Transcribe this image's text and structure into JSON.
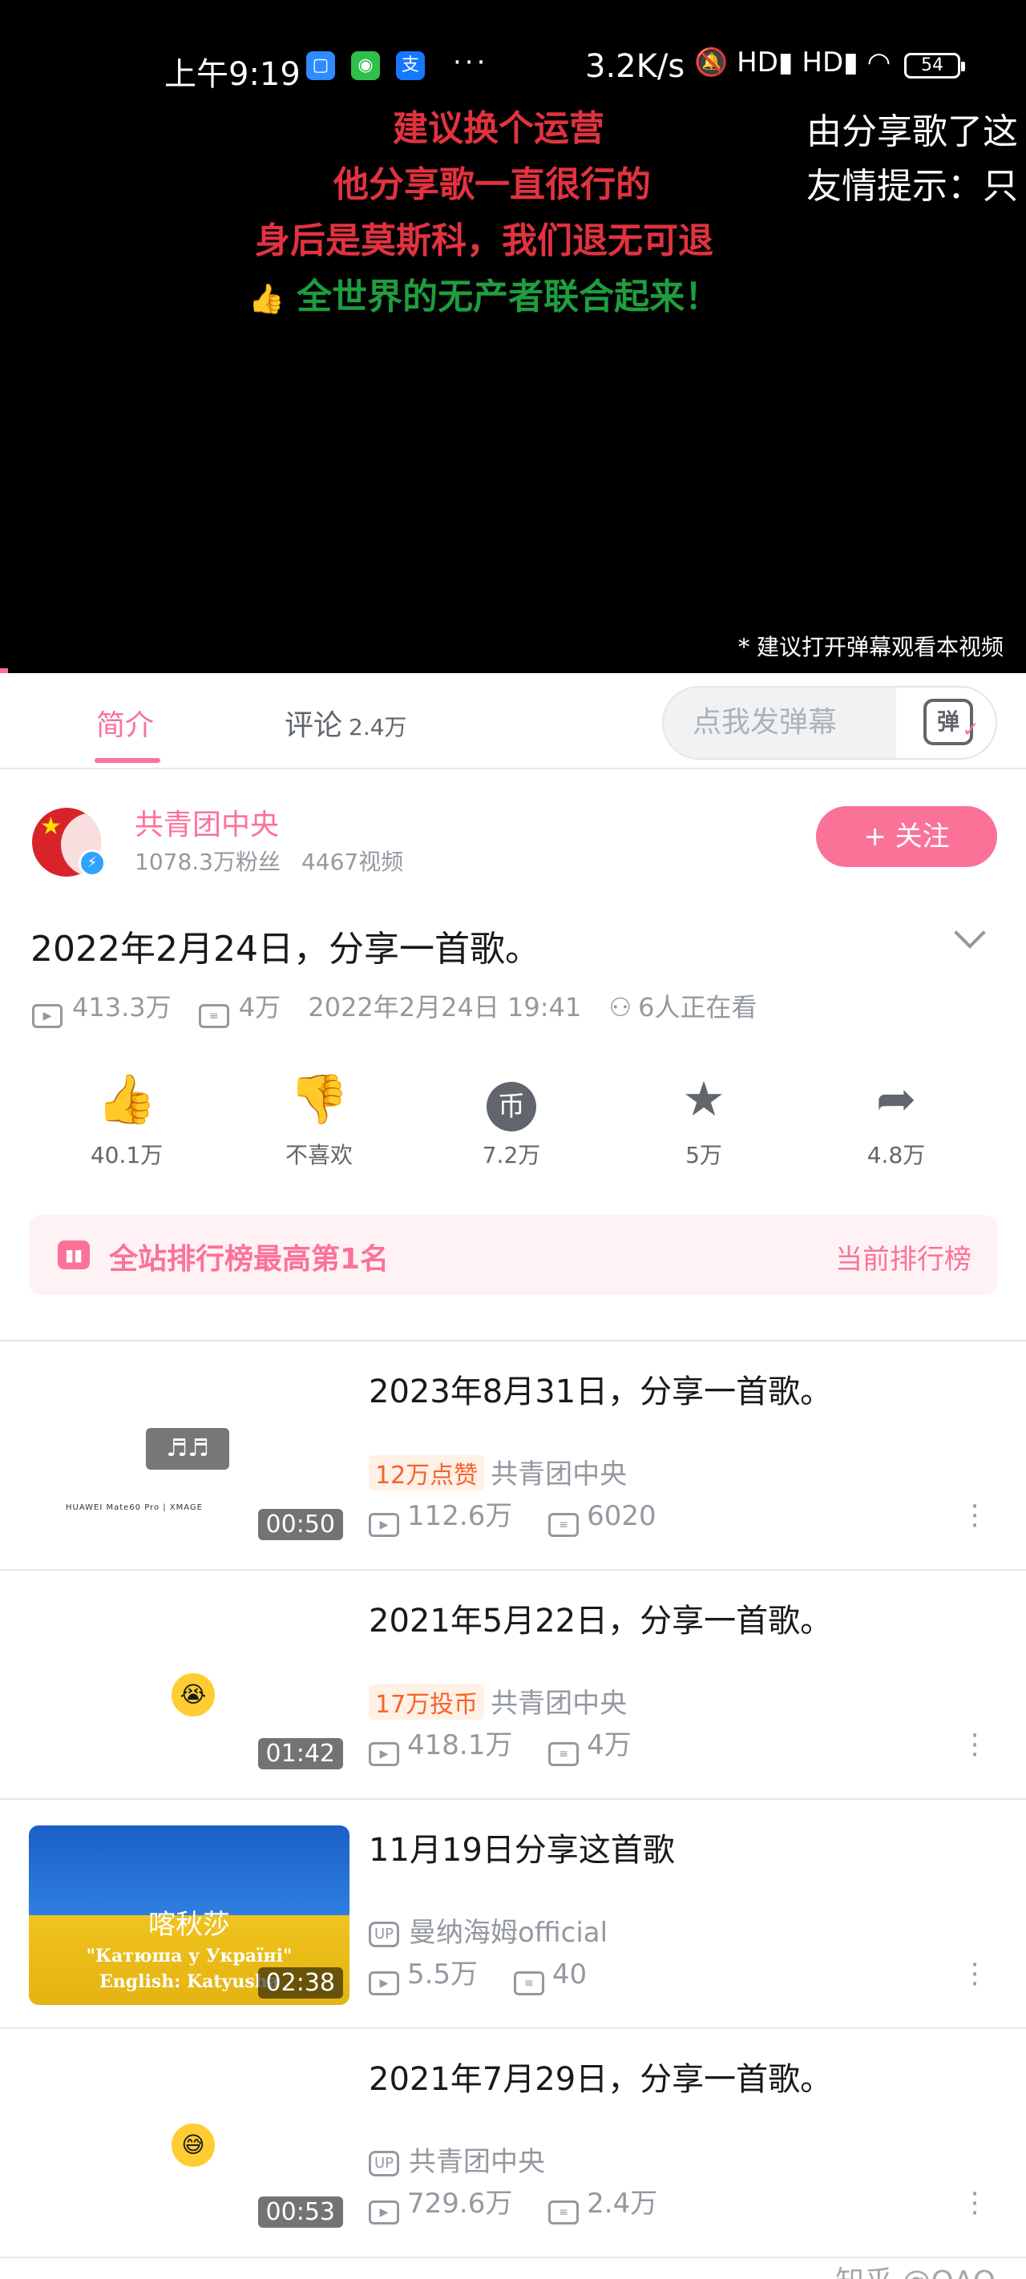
{
  "status_bar": {
    "time": "上午9:19",
    "app_icons": [
      "message-icon",
      "wechat-icon",
      "alipay-icon"
    ],
    "dots": "···",
    "network_speed": "3.2K/s",
    "indicators": "🔕 HD▮ HD▮ ◠",
    "battery": "54"
  },
  "video": {
    "danmaku": [
      {
        "text": "建议换个运营",
        "color": "#e2323f"
      },
      {
        "text": "他分享歌一直很行的",
        "color": "#e2323f"
      },
      {
        "text": "身后是莫斯科，我们退无可退",
        "color": "#e2323f"
      },
      {
        "text": "全世界的无产者联合起来！",
        "color": "#1f9d3f"
      },
      {
        "text": "由分享歌了这",
        "color": "#ffffff"
      },
      {
        "text": "友情提示：只",
        "color": "#ffffff"
      }
    ],
    "like_emoji": "👍",
    "hint": "* 建议打开弹幕观看本视频"
  },
  "tabs": {
    "intro": "简介",
    "comments": "评论",
    "comments_count": "2.4万",
    "danmaku_placeholder": "点我发弹幕",
    "danmaku_icon_text": "弹"
  },
  "uploader": {
    "name": "共青团中央",
    "followers": "1078.3万粉丝",
    "videos": "4467视频",
    "follow_label": "+ 关注"
  },
  "video_info": {
    "title": "2022年2月24日，分享一首歌。",
    "views": "413.3万",
    "danmaku_count": "4万",
    "datetime": "2022年2月24日 19:41",
    "watching": "6人正在看"
  },
  "actions": [
    {
      "icon": "thumbs-up-icon",
      "glyph": "👍",
      "label": "40.1万"
    },
    {
      "icon": "thumbs-down-icon",
      "glyph": "👎",
      "label": "不喜欢"
    },
    {
      "icon": "coin-icon",
      "glyph": "币",
      "label": "7.2万"
    },
    {
      "icon": "star-icon",
      "glyph": "★",
      "label": "5万"
    },
    {
      "icon": "share-icon",
      "glyph": "➦",
      "label": "4.8万"
    }
  ],
  "ranking": {
    "text": "全站排行榜最高第1名",
    "link": "当前排行榜"
  },
  "related": [
    {
      "title": "2023年8月31日，分享一首歌。",
      "tag": "12万点赞",
      "uploader": "共青团中央",
      "views": "112.6万",
      "danmaku": "6020",
      "duration": "00:50",
      "thumb_text": "♬♬",
      "thumb_caption": "HUAWEI Mate60 Pro | XMAGE"
    },
    {
      "title": "2021年5月22日，分享一首歌。",
      "tag": "17万投币",
      "uploader": "共青团中央",
      "views": "418.1万",
      "danmaku": "4万",
      "duration": "01:42",
      "thumb_text": "😭"
    },
    {
      "title": "11月19日分享这首歌",
      "up_badge": "UP",
      "uploader": "曼纳海姆official",
      "views": "5.5万",
      "danmaku": "40",
      "duration": "02:38",
      "thumb_text": "喀秋莎",
      "thumb_line2": "\"Катюша у Україні\"",
      "thumb_line3": "English: Katyusha"
    },
    {
      "title": "2021年7月29日，分享一首歌。",
      "up_badge": "UP",
      "uploader": "共青团中央",
      "views": "729.6万",
      "danmaku": "2.4万",
      "duration": "00:53",
      "thumb_text": "😅"
    }
  ],
  "watermark": "知乎 @QAQ",
  "colors": {
    "accent": "#fb7299",
    "danmaku_red": "#e2323f",
    "danmaku_green": "#1f9d3f",
    "tag_orange": "#f8622e"
  }
}
